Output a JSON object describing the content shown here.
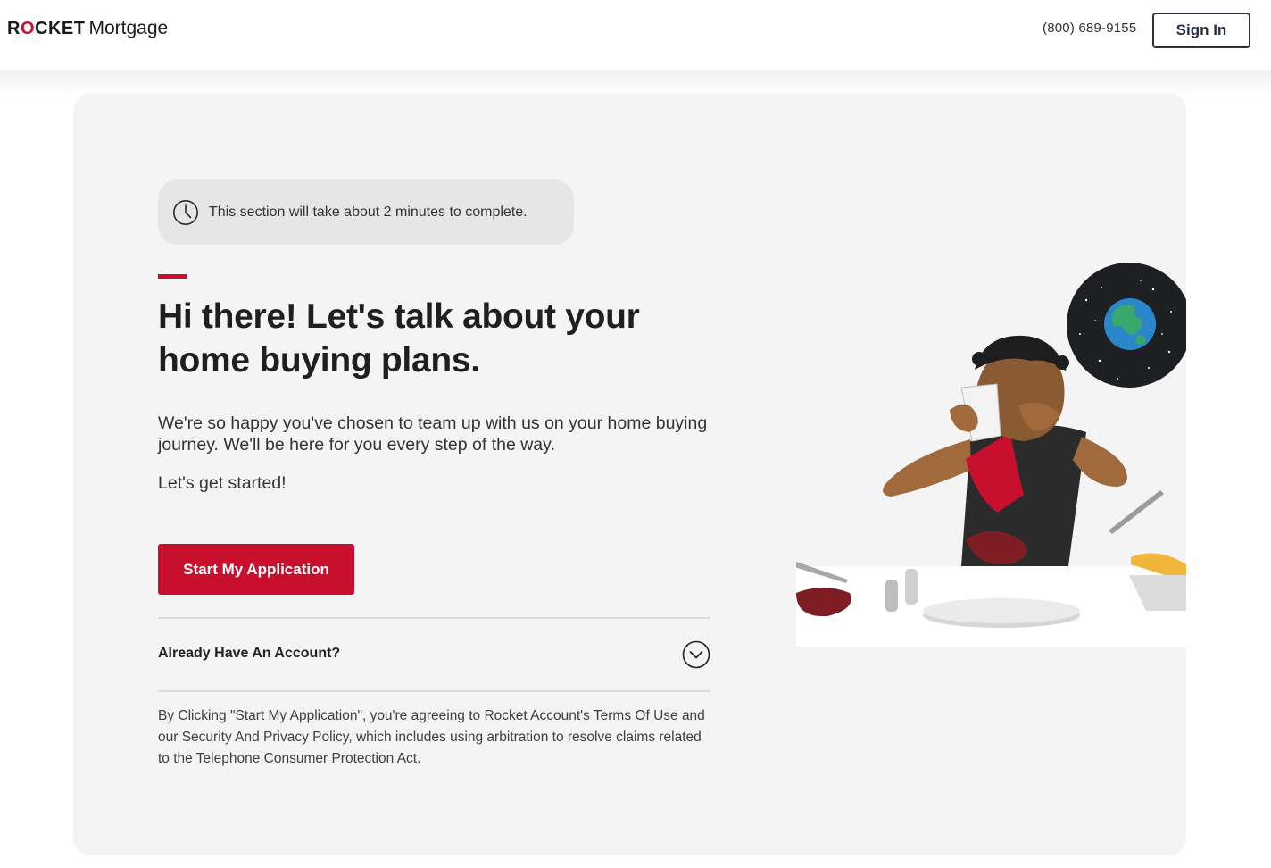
{
  "header": {
    "logo_rocket_pre": "R",
    "logo_rocket_o": "O",
    "logo_rocket_post": "CKET",
    "logo_mortgage": "Mortgage",
    "phone": "(800) 689-9155",
    "sign_in_label": "Sign In"
  },
  "main": {
    "time_notice": "This section will take about 2 minutes to complete.",
    "headline": "Hi there! Let's talk about your home buying plans.",
    "intro": "We're so happy you've chosen to team up with us on your home buying journey. We'll be here for you every step of the way.",
    "lets_get_started": "Let's get started!",
    "start_button_label": "Start My Application",
    "account_accordion_label": "Already Have An Account?",
    "disclaimer": "By Clicking \"Start My Application\", you're agreeing to Rocket Account's Terms Of Use and our Security And Privacy Policy, which includes using arbitration to resolve claims related to the Telephone Consumer Protection Act."
  },
  "icons": {
    "clock": "clock-icon",
    "chevron": "chevron-down-circle-icon"
  },
  "colors": {
    "brand_red": "#c8102e",
    "navy": "#2b2f45",
    "card_bg": "#f4f4f4",
    "pill_bg": "#e6e6e6"
  }
}
